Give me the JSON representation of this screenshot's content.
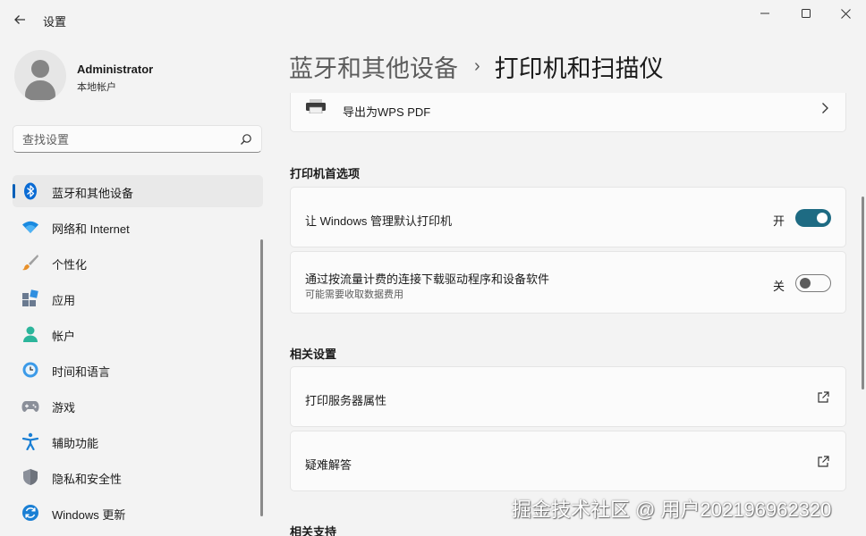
{
  "window": {
    "title": "设置",
    "colors": {
      "accent": "#005fb8",
      "toggle_on": "#1e6b83",
      "background": "#f3f3f3",
      "card": "#fbfbfb"
    }
  },
  "profile": {
    "name": "Administrator",
    "account_type": "本地帐户"
  },
  "search": {
    "placeholder": "查找设置"
  },
  "sidebar": {
    "items": [
      {
        "label": "蓝牙和其他设备",
        "icon": "bluetooth-icon",
        "active": true
      },
      {
        "label": "网络和 Internet",
        "icon": "wifi-icon",
        "active": false
      },
      {
        "label": "个性化",
        "icon": "brush-icon",
        "active": false
      },
      {
        "label": "应用",
        "icon": "apps-icon",
        "active": false
      },
      {
        "label": "帐户",
        "icon": "person-icon",
        "active": false
      },
      {
        "label": "时间和语言",
        "icon": "globe-clock-icon",
        "active": false
      },
      {
        "label": "游戏",
        "icon": "gamepad-icon",
        "active": false
      },
      {
        "label": "辅助功能",
        "icon": "accessibility-icon",
        "active": false
      },
      {
        "label": "隐私和安全性",
        "icon": "shield-icon",
        "active": false
      },
      {
        "label": "Windows 更新",
        "icon": "update-icon",
        "active": false
      }
    ]
  },
  "header": {
    "parent": "蓝牙和其他设备",
    "separator": "›",
    "current": "打印机和扫描仪"
  },
  "content": {
    "export_item": {
      "label": "导出为WPS PDF",
      "icon": "printer-icon"
    },
    "printer_prefs": {
      "title": "打印机首选项",
      "default_printer": {
        "label": "让 Windows 管理默认打印机",
        "state_text": "开",
        "on": true
      },
      "metered": {
        "label": "通过按流量计费的连接下载驱动程序和设备软件",
        "sub": "可能需要收取数据费用",
        "state_text": "关",
        "on": false
      }
    },
    "related_settings": {
      "title": "相关设置",
      "items": [
        {
          "label": "打印服务器属性",
          "icon": "external-link-icon"
        },
        {
          "label": "疑难解答",
          "icon": "external-link-icon"
        }
      ]
    },
    "related_support": {
      "title": "相关支持"
    }
  },
  "watermark": "掘金技术社区 @ 用户202196962320"
}
